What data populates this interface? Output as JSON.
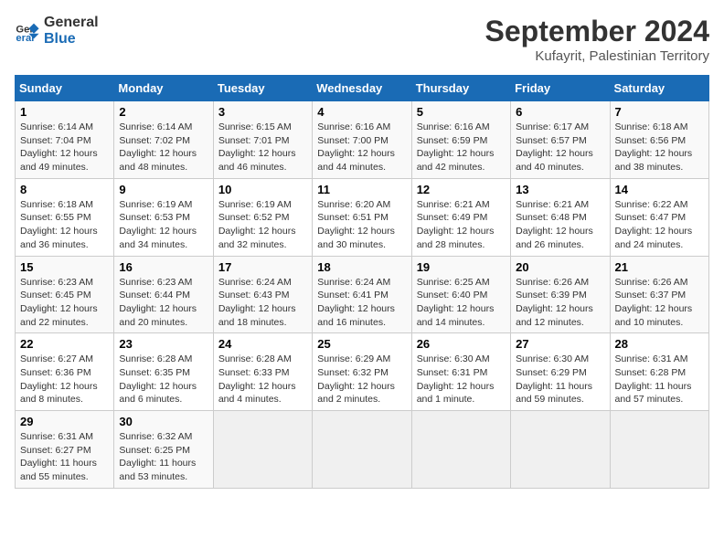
{
  "header": {
    "logo_line1": "General",
    "logo_line2": "Blue",
    "title": "September 2024",
    "subtitle": "Kufayrit, Palestinian Territory"
  },
  "columns": [
    "Sunday",
    "Monday",
    "Tuesday",
    "Wednesday",
    "Thursday",
    "Friday",
    "Saturday"
  ],
  "weeks": [
    [
      {
        "day": "1",
        "sunrise": "6:14 AM",
        "sunset": "7:04 PM",
        "daylight": "12 hours and 49 minutes."
      },
      {
        "day": "2",
        "sunrise": "6:14 AM",
        "sunset": "7:02 PM",
        "daylight": "12 hours and 48 minutes."
      },
      {
        "day": "3",
        "sunrise": "6:15 AM",
        "sunset": "7:01 PM",
        "daylight": "12 hours and 46 minutes."
      },
      {
        "day": "4",
        "sunrise": "6:16 AM",
        "sunset": "7:00 PM",
        "daylight": "12 hours and 44 minutes."
      },
      {
        "day": "5",
        "sunrise": "6:16 AM",
        "sunset": "6:59 PM",
        "daylight": "12 hours and 42 minutes."
      },
      {
        "day": "6",
        "sunrise": "6:17 AM",
        "sunset": "6:57 PM",
        "daylight": "12 hours and 40 minutes."
      },
      {
        "day": "7",
        "sunrise": "6:18 AM",
        "sunset": "6:56 PM",
        "daylight": "12 hours and 38 minutes."
      }
    ],
    [
      {
        "day": "8",
        "sunrise": "6:18 AM",
        "sunset": "6:55 PM",
        "daylight": "12 hours and 36 minutes."
      },
      {
        "day": "9",
        "sunrise": "6:19 AM",
        "sunset": "6:53 PM",
        "daylight": "12 hours and 34 minutes."
      },
      {
        "day": "10",
        "sunrise": "6:19 AM",
        "sunset": "6:52 PM",
        "daylight": "12 hours and 32 minutes."
      },
      {
        "day": "11",
        "sunrise": "6:20 AM",
        "sunset": "6:51 PM",
        "daylight": "12 hours and 30 minutes."
      },
      {
        "day": "12",
        "sunrise": "6:21 AM",
        "sunset": "6:49 PM",
        "daylight": "12 hours and 28 minutes."
      },
      {
        "day": "13",
        "sunrise": "6:21 AM",
        "sunset": "6:48 PM",
        "daylight": "12 hours and 26 minutes."
      },
      {
        "day": "14",
        "sunrise": "6:22 AM",
        "sunset": "6:47 PM",
        "daylight": "12 hours and 24 minutes."
      }
    ],
    [
      {
        "day": "15",
        "sunrise": "6:23 AM",
        "sunset": "6:45 PM",
        "daylight": "12 hours and 22 minutes."
      },
      {
        "day": "16",
        "sunrise": "6:23 AM",
        "sunset": "6:44 PM",
        "daylight": "12 hours and 20 minutes."
      },
      {
        "day": "17",
        "sunrise": "6:24 AM",
        "sunset": "6:43 PM",
        "daylight": "12 hours and 18 minutes."
      },
      {
        "day": "18",
        "sunrise": "6:24 AM",
        "sunset": "6:41 PM",
        "daylight": "12 hours and 16 minutes."
      },
      {
        "day": "19",
        "sunrise": "6:25 AM",
        "sunset": "6:40 PM",
        "daylight": "12 hours and 14 minutes."
      },
      {
        "day": "20",
        "sunrise": "6:26 AM",
        "sunset": "6:39 PM",
        "daylight": "12 hours and 12 minutes."
      },
      {
        "day": "21",
        "sunrise": "6:26 AM",
        "sunset": "6:37 PM",
        "daylight": "12 hours and 10 minutes."
      }
    ],
    [
      {
        "day": "22",
        "sunrise": "6:27 AM",
        "sunset": "6:36 PM",
        "daylight": "12 hours and 8 minutes."
      },
      {
        "day": "23",
        "sunrise": "6:28 AM",
        "sunset": "6:35 PM",
        "daylight": "12 hours and 6 minutes."
      },
      {
        "day": "24",
        "sunrise": "6:28 AM",
        "sunset": "6:33 PM",
        "daylight": "12 hours and 4 minutes."
      },
      {
        "day": "25",
        "sunrise": "6:29 AM",
        "sunset": "6:32 PM",
        "daylight": "12 hours and 2 minutes."
      },
      {
        "day": "26",
        "sunrise": "6:30 AM",
        "sunset": "6:31 PM",
        "daylight": "12 hours and 1 minute."
      },
      {
        "day": "27",
        "sunrise": "6:30 AM",
        "sunset": "6:29 PM",
        "daylight": "11 hours and 59 minutes."
      },
      {
        "day": "28",
        "sunrise": "6:31 AM",
        "sunset": "6:28 PM",
        "daylight": "11 hours and 57 minutes."
      }
    ],
    [
      {
        "day": "29",
        "sunrise": "6:31 AM",
        "sunset": "6:27 PM",
        "daylight": "11 hours and 55 minutes."
      },
      {
        "day": "30",
        "sunrise": "6:32 AM",
        "sunset": "6:25 PM",
        "daylight": "11 hours and 53 minutes."
      },
      null,
      null,
      null,
      null,
      null
    ]
  ]
}
